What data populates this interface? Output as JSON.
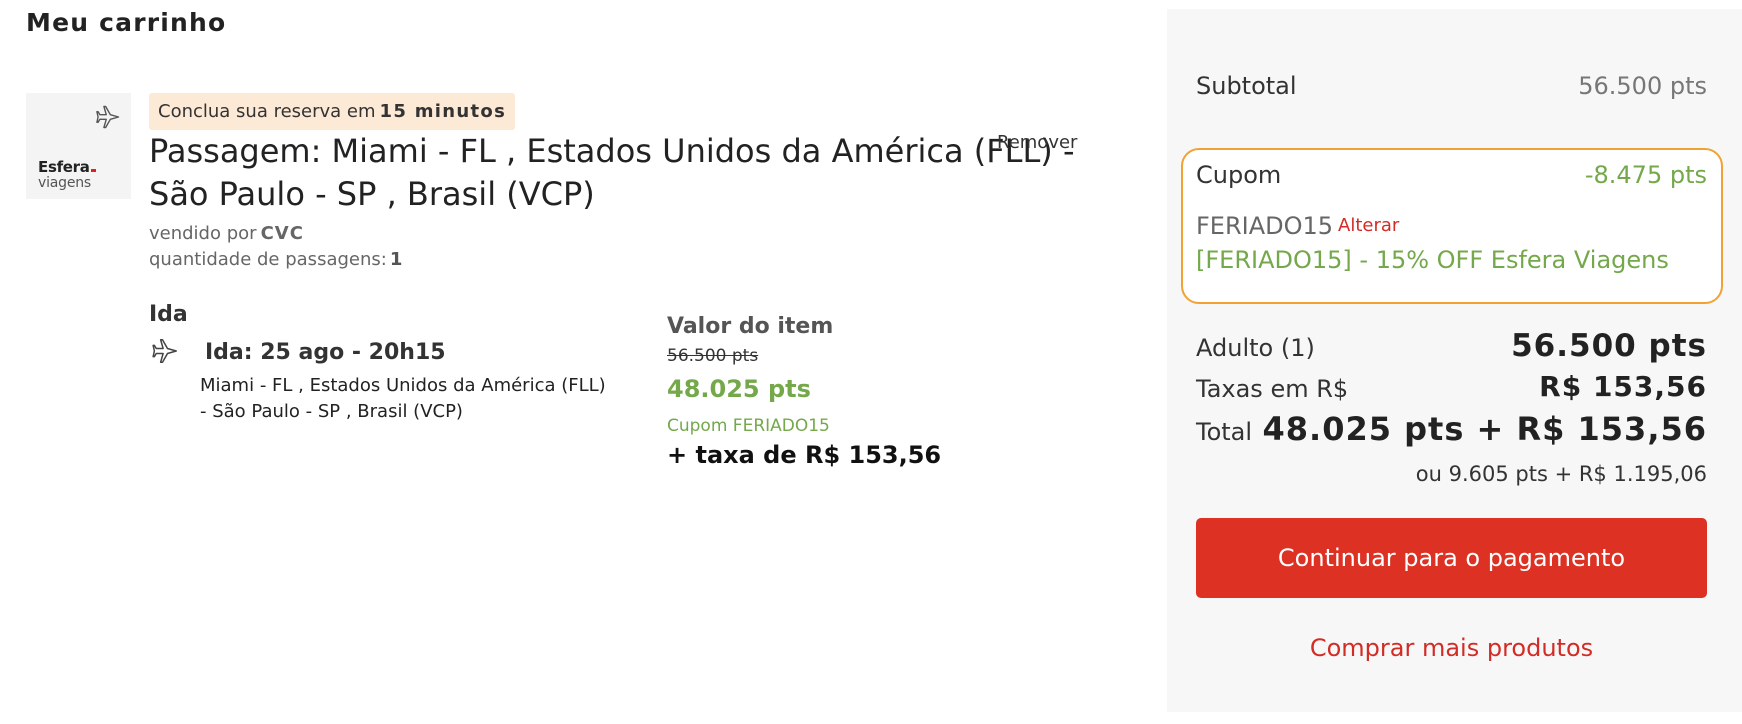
{
  "page": {
    "title": "Meu carrinho"
  },
  "item": {
    "logo": {
      "brand_top": "Esfera",
      "brand_bottom": "viagens"
    },
    "timer": {
      "prefix": "Conclua sua reserva em",
      "time": "15 minutos"
    },
    "title_line1": "Passagem: Miami - FL , Estados Unidos da América (FLL) -",
    "title_line2": "São Paulo - SP , Brasil (VCP)",
    "remove_label": "Remover",
    "seller": {
      "label": "vendido por",
      "value": "CVC"
    },
    "quantity": {
      "label": "quantidade de passagens:",
      "value": "1"
    },
    "leg": {
      "title": "Ida",
      "date": "Ida: 25 ago - 20h15",
      "route_line1": "Miami - FL , Estados Unidos da América (FLL)",
      "route_line2": "- São Paulo - SP , Brasil (VCP)"
    },
    "value": {
      "label": "Valor do item",
      "original": "56.500 pts",
      "discounted": "48.025 pts",
      "coupon": "Cupom FERIADO15",
      "tax": "+ taxa de R$ 153,56"
    }
  },
  "summary": {
    "subtotal_label": "Subtotal",
    "subtotal_value": "56.500 pts",
    "coupon": {
      "label": "Cupom",
      "discount": "-8.475 pts",
      "code": "FERIADO15",
      "change_label": "Alterar",
      "description": "[FERIADO15] - 15% OFF Esfera Viagens"
    },
    "adult_label": "Adulto (1)",
    "adult_value": "56.500 pts",
    "taxes_label": "Taxas em R$",
    "taxes_value": "R$ 153,56",
    "total_label": "Total",
    "total_value": "48.025 pts + R$ 153,56",
    "alternative": "ou 9.605 pts + R$ 1.195,06",
    "pay_button": "Continuar para o pagamento",
    "more_products": "Comprar mais produtos"
  },
  "colors": {
    "accent_red": "#dc3123",
    "discount_green": "#74a84b",
    "coupon_border": "#f2a234",
    "timer_bg": "#fce9d6"
  },
  "icons": {
    "logo": "airplane-icon",
    "leg": "airplane-icon"
  }
}
